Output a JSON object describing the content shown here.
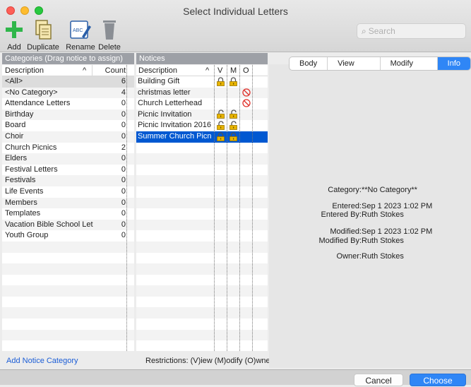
{
  "window": {
    "title": "Select Individual Letters"
  },
  "toolbar": {
    "add_label": "Add",
    "duplicate_label": "Duplicate",
    "rename_label": "Rename",
    "delete_label": "Delete",
    "search_placeholder": "Search"
  },
  "categories": {
    "header": "Categories (Drag notice to assign)",
    "col_description": "Description",
    "col_count": "Count",
    "sort_indicator": "^",
    "items": [
      {
        "label": "<All>",
        "count": "6"
      },
      {
        "label": "<No Category>",
        "count": "4"
      },
      {
        "label": "Attendance Letters",
        "count": "0"
      },
      {
        "label": "Birthday",
        "count": "0"
      },
      {
        "label": "Board",
        "count": "0"
      },
      {
        "label": "Choir",
        "count": "0"
      },
      {
        "label": "Church Picnics",
        "count": "2"
      },
      {
        "label": "Elders",
        "count": "0"
      },
      {
        "label": "Festival Letters",
        "count": "0"
      },
      {
        "label": "Festivals",
        "count": "0"
      },
      {
        "label": "Life Events",
        "count": "0"
      },
      {
        "label": "Members",
        "count": "0"
      },
      {
        "label": "Templates",
        "count": "0"
      },
      {
        "label": "Vacation Bible School Let",
        "count": "0"
      },
      {
        "label": "Youth Group",
        "count": "0"
      }
    ],
    "add_link": "Add Notice Category"
  },
  "notices": {
    "header": "Notices",
    "col_description": "Description",
    "sort_indicator": "^",
    "col_v": "V",
    "col_m": "M",
    "col_o": "O",
    "items": [
      {
        "label": "Building Gift",
        "v": "lock-closed",
        "m": "lock-closed",
        "o": ""
      },
      {
        "label": "christmas letter",
        "v": "",
        "m": "",
        "o": "prohibited"
      },
      {
        "label": "Church Letterhead",
        "v": "",
        "m": "",
        "o": "prohibited"
      },
      {
        "label": "Picnic Invitation",
        "v": "lock-open",
        "m": "lock-open",
        "o": ""
      },
      {
        "label": "Picnic Invitation 2016",
        "v": "lock-open",
        "m": "lock-open",
        "o": ""
      },
      {
        "label": "Summer Church Picnic",
        "v": "lock-closed",
        "m": "lock-closed",
        "o": "",
        "selected": true
      }
    ],
    "restrictions": "Restrictions: (V)iew (M)odify (O)wned"
  },
  "tabs": [
    {
      "label": "Body",
      "active": false
    },
    {
      "label": "View Access",
      "active": false
    },
    {
      "label": "Modify Access",
      "active": false
    },
    {
      "label": "Info",
      "active": true
    }
  ],
  "info": {
    "category_label": "Category:",
    "category_value": "**No Category**",
    "entered_label": "Entered:",
    "entered_value": "Sep 1 2023 1:02 PM",
    "entered_by_label": "Entered By:",
    "entered_by_value": "Ruth Stokes",
    "modified_label": "Modified:",
    "modified_value": "Sep 1 2023 1:02 PM",
    "modified_by_label": "Modified By:",
    "modified_by_value": "Ruth Stokes",
    "owner_label": "Owner:",
    "owner_value": "Ruth Stokes"
  },
  "footer": {
    "cancel_label": "Cancel",
    "choose_label": "Choose"
  },
  "colors": {
    "selection": "#0058d1",
    "accent": "#2f86f6",
    "lock_gold": "#e8b400",
    "prohibited_red": "#e0302a",
    "add_green": "#2fb64a"
  }
}
